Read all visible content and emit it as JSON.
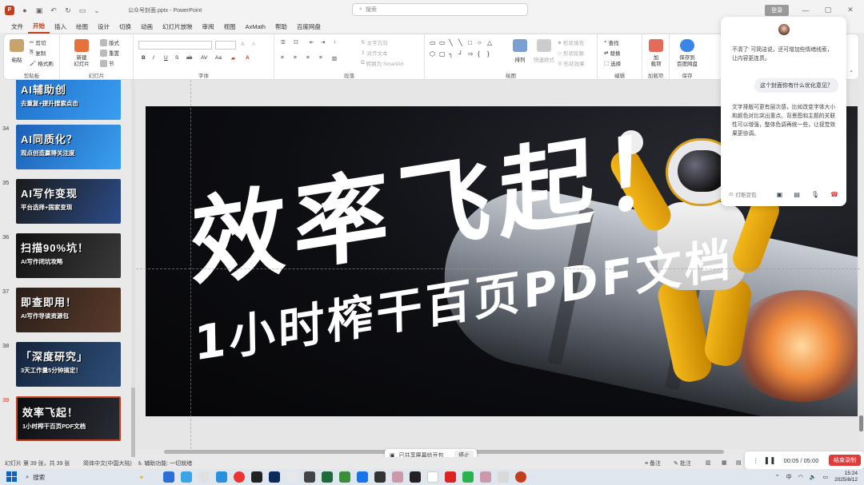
{
  "titlebar": {
    "filename": "公众号封面.pptx",
    "separator": "-",
    "app": "PowerPoint",
    "search_placeholder": "搜索",
    "login": "登录"
  },
  "menu": [
    "文件",
    "开始",
    "插入",
    "绘图",
    "设计",
    "切换",
    "动画",
    "幻灯片放映",
    "审阅",
    "视图",
    "AxMath",
    "帮助",
    "百度网盘"
  ],
  "ribbon": {
    "paste": "粘贴",
    "cut": "剪切",
    "copy": "复制",
    "format_painter": "格式刷",
    "clipboard": "剪贴板",
    "new_slide": "新建\n幻灯片",
    "layout": "版式",
    "reset": "重置",
    "section": "节",
    "slides": "幻灯片",
    "font": "字体",
    "text_direction": "文字方向",
    "align_text": "对齐文本",
    "smartart": "转换为 SmartArt",
    "paragraph": "段落",
    "arrange": "排列",
    "quick_styles": "快速样式",
    "shape_fill": "形状填充",
    "shape_outline": "形状轮廓",
    "shape_effects": "形状效果",
    "drawing": "绘图",
    "find": "查找",
    "replace": "替换",
    "select": "选择",
    "editing": "编辑",
    "addin": "加\n载项",
    "addins": "加载项",
    "save_baidu": "保存到\n百度网盘",
    "save": "保存"
  },
  "thumbnails": [
    {
      "num": "",
      "line1": "AI辅助创",
      "line2": "去重复+提升搜索点击",
      "bg": "#1f6fc9"
    },
    {
      "num": "34",
      "line1": "AI同质化？",
      "line2": "观点创造赢得关注度",
      "bg": "#2a7fd6"
    },
    {
      "num": "35",
      "line1": "AI写作变现",
      "line2": "平台选择+国家变现",
      "bg": "#2b2b2b"
    },
    {
      "num": "36",
      "line1": "扫描90%坑！",
      "line2": "AI写作闭坑攻略",
      "bg": "#1b1b1b"
    },
    {
      "num": "37",
      "line1": "即查即用！",
      "line2": "AI写作导读资源包",
      "bg": "#3a2a24"
    },
    {
      "num": "38",
      "line1": "「深度研究」",
      "line2": "3天工作量5分钟搞定！",
      "bg": "#1d3554"
    },
    {
      "num": "39",
      "line1": "效率飞起！",
      "line2": "1小时榨干百页PDF文档",
      "bg": "#111318"
    }
  ],
  "slide": {
    "title": "效率飞起！",
    "subtitle": "1小时榨干百页PDF文档"
  },
  "chat": {
    "msg1": "不清了' 可简洁说，还可增加些情绪线索，让内容更连贯。",
    "user_msg": "这个封面你有什么优化意见？",
    "msg2": "文字排版可更有层次感，比如改变字体大小和颜色对比突出重点。背景图和主题的关联性可以增强，整体色调再统一些，让视觉效果更协调。",
    "interrupt": "打断豆包"
  },
  "sharebar": {
    "text": "已共享屏幕给豆包",
    "stop": "停止"
  },
  "status": {
    "slide_info": "幻灯片 第 39 张，共 39 张",
    "language": "简体中文(中国大陆)",
    "accessibility": "辅助功能: 一切就绪",
    "notes": "备注",
    "comments": "批注"
  },
  "recorder": {
    "time": "00:05 / 05:00",
    "end": "结束录制"
  },
  "taskbar": {
    "search": "搜索",
    "ime": "中",
    "time": "15:24",
    "date": "2025/8/12"
  }
}
